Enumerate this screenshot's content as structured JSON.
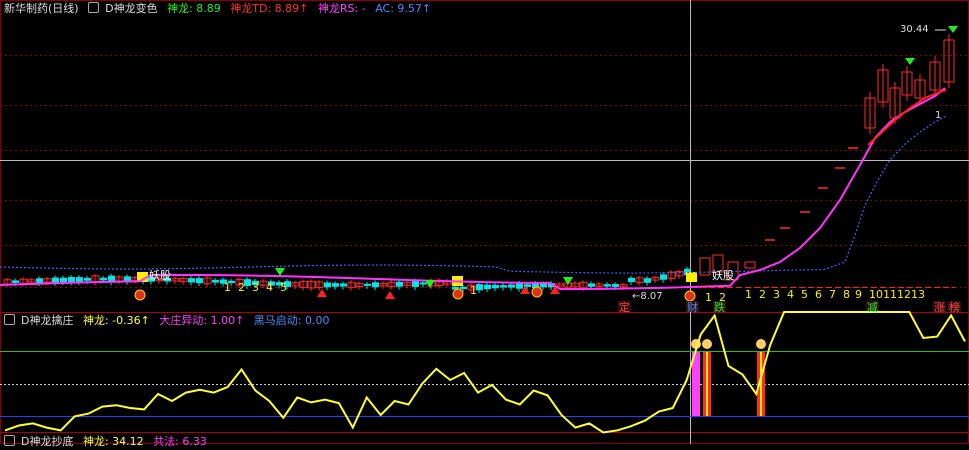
{
  "header": {
    "stock_name": "新华制药(日线)",
    "indicator_name": "D神龙变色",
    "items": [
      {
        "label": "神龙: 8.89",
        "color": "#22ee22"
      },
      {
        "label": "神龙TD: 8.89↑",
        "color": "#ff3030"
      },
      {
        "label": "神龙RS: -",
        "color": "#ff40ff"
      },
      {
        "label": "AC: 9.57↑",
        "color": "#4a8cff"
      }
    ]
  },
  "main_chart": {
    "high_label": "30.44",
    "low_label": "8.07",
    "marker_1": "1",
    "demon_label": "妖股",
    "demon_label_2": "妖股",
    "count_left": [
      "1",
      "2",
      "3",
      "4",
      "5"
    ],
    "count_mid": [
      "1"
    ],
    "count_right_a": [
      "1",
      "2"
    ],
    "count_right_b": [
      "1",
      "2",
      "3",
      "4",
      "5",
      "6",
      "7",
      "8",
      "9",
      "10",
      "11",
      "12",
      "13"
    ],
    "bottom_tags": [
      {
        "text": "定",
        "color": "#ff4040"
      },
      {
        "text": "财",
        "color": "#4a8cff"
      },
      {
        "text": "跌",
        "color": "#22ee22"
      },
      {
        "text": "减",
        "color": "#22ee22"
      },
      {
        "text": "涨",
        "color": "#ff4040"
      },
      {
        "text": "榜",
        "color": "#ff4040"
      }
    ],
    "colors": {
      "up": "#ff2a2a",
      "down": "#00e5e5",
      "ma": "#ff33ff",
      "trail": "#4060ff",
      "grid": "#8b0000"
    }
  },
  "indicator": {
    "title": "D神龙擒庄",
    "items": [
      {
        "label": "神龙: -0.36↑",
        "color": "#ffff40"
      },
      {
        "label": "大庄异动: 1.00↑",
        "color": "#ff40ff"
      },
      {
        "label": "黑马启动: 0.00",
        "color": "#4a8cff"
      }
    ],
    "line_values": [
      0.08,
      0.15,
      0.18,
      0.12,
      0.08,
      0.28,
      0.32,
      0.42,
      0.44,
      0.4,
      0.38,
      0.6,
      0.5,
      0.62,
      0.66,
      0.62,
      0.7,
      0.95,
      0.65,
      0.5,
      0.26,
      0.55,
      0.48,
      0.52,
      0.47,
      0.12,
      0.55,
      0.3,
      0.5,
      0.45,
      0.75,
      0.96,
      0.8,
      0.9,
      0.62,
      0.73,
      0.52,
      0.45,
      0.65,
      0.58,
      0.3,
      0.12,
      0.18,
      0.05,
      0.08,
      0.14,
      0.22,
      0.35,
      0.4,
      0.8,
      1.45,
      1.55,
      1.0,
      0.88,
      0.6,
      1.3,
      1.6,
      1.6,
      1.6,
      1.6,
      1.6,
      1.6,
      1.6,
      1.6,
      1.6,
      1.6,
      1.4,
      1.42,
      1.55,
      1.35
    ],
    "spikes_at": [
      50,
      51,
      52,
      56
    ]
  },
  "sub_header": {
    "title": "D神龙抄底",
    "items": [
      "神龙: 34.12",
      "共法: 6.33"
    ]
  }
}
